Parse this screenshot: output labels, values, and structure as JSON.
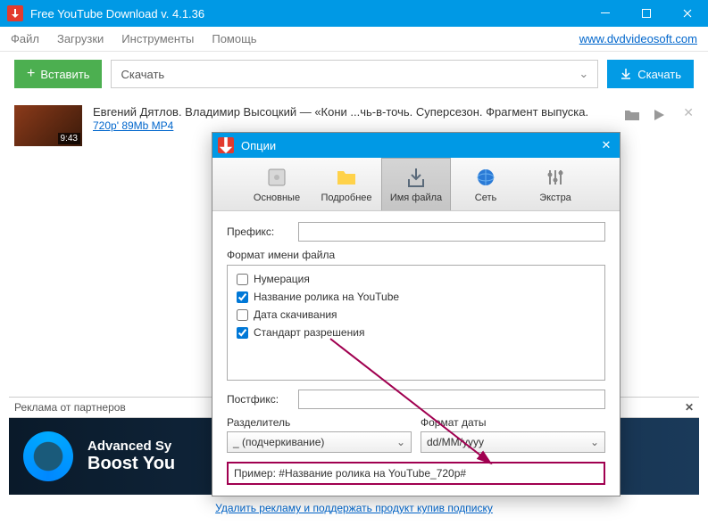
{
  "window": {
    "title": "Free YouTube Download v. 4.1.36"
  },
  "menu": {
    "file": "Файл",
    "downloads": "Загрузки",
    "tools": "Инструменты",
    "help": "Помощь",
    "site_link": "www.dvdvideosoft.com"
  },
  "toolbar": {
    "paste": "Вставить",
    "combo_value": "Скачать",
    "download": "Скачать"
  },
  "video": {
    "title": "Евгений Дятлов. Владимир Высоцкий — «Кони ...чь-в-точь. Суперсезон. Фрагмент выпуска.",
    "meta": "720p' 89Mb MP4",
    "duration": "9:43"
  },
  "ad": {
    "header": "Реклама от партнеров",
    "line1": "Advanced Sy",
    "line2": "Boost You",
    "remove_link": "Удалить рекламу и поддержать продукт купив подписку"
  },
  "dialog": {
    "title": "Опции",
    "tabs": {
      "main": "Основные",
      "more": "Подробнее",
      "filename": "Имя файла",
      "network": "Сеть",
      "extra": "Экстра"
    },
    "prefix_label": "Префикс:",
    "prefix_value": "",
    "format_title": "Формат имени файла",
    "checks": {
      "numbering": "Нумерация",
      "yt_title": "Название ролика на YouTube",
      "date": "Дата скачивания",
      "resolution": "Стандарт разрешения"
    },
    "postfix_label": "Постфикс:",
    "postfix_value": "",
    "separator_label": "Разделитель",
    "separator_value": "_ (подчеркивание)",
    "dateformat_label": "Формат даты",
    "dateformat_value": "dd/MM/yyyy",
    "example_label": "Пример:",
    "example_value": "#Название ролика на YouTube_720p#"
  }
}
